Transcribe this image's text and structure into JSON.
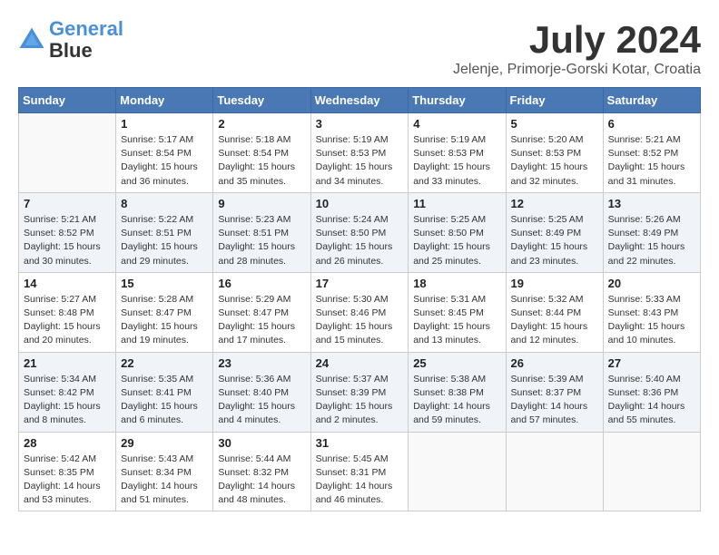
{
  "header": {
    "logo_line1": "General",
    "logo_line2": "Blue",
    "month_year": "July 2024",
    "location": "Jelenje, Primorje-Gorski Kotar, Croatia"
  },
  "weekdays": [
    "Sunday",
    "Monday",
    "Tuesday",
    "Wednesday",
    "Thursday",
    "Friday",
    "Saturday"
  ],
  "weeks": [
    [
      {
        "day": "",
        "info": ""
      },
      {
        "day": "1",
        "info": "Sunrise: 5:17 AM\nSunset: 8:54 PM\nDaylight: 15 hours\nand 36 minutes."
      },
      {
        "day": "2",
        "info": "Sunrise: 5:18 AM\nSunset: 8:54 PM\nDaylight: 15 hours\nand 35 minutes."
      },
      {
        "day": "3",
        "info": "Sunrise: 5:19 AM\nSunset: 8:53 PM\nDaylight: 15 hours\nand 34 minutes."
      },
      {
        "day": "4",
        "info": "Sunrise: 5:19 AM\nSunset: 8:53 PM\nDaylight: 15 hours\nand 33 minutes."
      },
      {
        "day": "5",
        "info": "Sunrise: 5:20 AM\nSunset: 8:53 PM\nDaylight: 15 hours\nand 32 minutes."
      },
      {
        "day": "6",
        "info": "Sunrise: 5:21 AM\nSunset: 8:52 PM\nDaylight: 15 hours\nand 31 minutes."
      }
    ],
    [
      {
        "day": "7",
        "info": "Sunrise: 5:21 AM\nSunset: 8:52 PM\nDaylight: 15 hours\nand 30 minutes."
      },
      {
        "day": "8",
        "info": "Sunrise: 5:22 AM\nSunset: 8:51 PM\nDaylight: 15 hours\nand 29 minutes."
      },
      {
        "day": "9",
        "info": "Sunrise: 5:23 AM\nSunset: 8:51 PM\nDaylight: 15 hours\nand 28 minutes."
      },
      {
        "day": "10",
        "info": "Sunrise: 5:24 AM\nSunset: 8:50 PM\nDaylight: 15 hours\nand 26 minutes."
      },
      {
        "day": "11",
        "info": "Sunrise: 5:25 AM\nSunset: 8:50 PM\nDaylight: 15 hours\nand 25 minutes."
      },
      {
        "day": "12",
        "info": "Sunrise: 5:25 AM\nSunset: 8:49 PM\nDaylight: 15 hours\nand 23 minutes."
      },
      {
        "day": "13",
        "info": "Sunrise: 5:26 AM\nSunset: 8:49 PM\nDaylight: 15 hours\nand 22 minutes."
      }
    ],
    [
      {
        "day": "14",
        "info": "Sunrise: 5:27 AM\nSunset: 8:48 PM\nDaylight: 15 hours\nand 20 minutes."
      },
      {
        "day": "15",
        "info": "Sunrise: 5:28 AM\nSunset: 8:47 PM\nDaylight: 15 hours\nand 19 minutes."
      },
      {
        "day": "16",
        "info": "Sunrise: 5:29 AM\nSunset: 8:47 PM\nDaylight: 15 hours\nand 17 minutes."
      },
      {
        "day": "17",
        "info": "Sunrise: 5:30 AM\nSunset: 8:46 PM\nDaylight: 15 hours\nand 15 minutes."
      },
      {
        "day": "18",
        "info": "Sunrise: 5:31 AM\nSunset: 8:45 PM\nDaylight: 15 hours\nand 13 minutes."
      },
      {
        "day": "19",
        "info": "Sunrise: 5:32 AM\nSunset: 8:44 PM\nDaylight: 15 hours\nand 12 minutes."
      },
      {
        "day": "20",
        "info": "Sunrise: 5:33 AM\nSunset: 8:43 PM\nDaylight: 15 hours\nand 10 minutes."
      }
    ],
    [
      {
        "day": "21",
        "info": "Sunrise: 5:34 AM\nSunset: 8:42 PM\nDaylight: 15 hours\nand 8 minutes."
      },
      {
        "day": "22",
        "info": "Sunrise: 5:35 AM\nSunset: 8:41 PM\nDaylight: 15 hours\nand 6 minutes."
      },
      {
        "day": "23",
        "info": "Sunrise: 5:36 AM\nSunset: 8:40 PM\nDaylight: 15 hours\nand 4 minutes."
      },
      {
        "day": "24",
        "info": "Sunrise: 5:37 AM\nSunset: 8:39 PM\nDaylight: 15 hours\nand 2 minutes."
      },
      {
        "day": "25",
        "info": "Sunrise: 5:38 AM\nSunset: 8:38 PM\nDaylight: 14 hours\nand 59 minutes."
      },
      {
        "day": "26",
        "info": "Sunrise: 5:39 AM\nSunset: 8:37 PM\nDaylight: 14 hours\nand 57 minutes."
      },
      {
        "day": "27",
        "info": "Sunrise: 5:40 AM\nSunset: 8:36 PM\nDaylight: 14 hours\nand 55 minutes."
      }
    ],
    [
      {
        "day": "28",
        "info": "Sunrise: 5:42 AM\nSunset: 8:35 PM\nDaylight: 14 hours\nand 53 minutes."
      },
      {
        "day": "29",
        "info": "Sunrise: 5:43 AM\nSunset: 8:34 PM\nDaylight: 14 hours\nand 51 minutes."
      },
      {
        "day": "30",
        "info": "Sunrise: 5:44 AM\nSunset: 8:32 PM\nDaylight: 14 hours\nand 48 minutes."
      },
      {
        "day": "31",
        "info": "Sunrise: 5:45 AM\nSunset: 8:31 PM\nDaylight: 14 hours\nand 46 minutes."
      },
      {
        "day": "",
        "info": ""
      },
      {
        "day": "",
        "info": ""
      },
      {
        "day": "",
        "info": ""
      }
    ]
  ]
}
